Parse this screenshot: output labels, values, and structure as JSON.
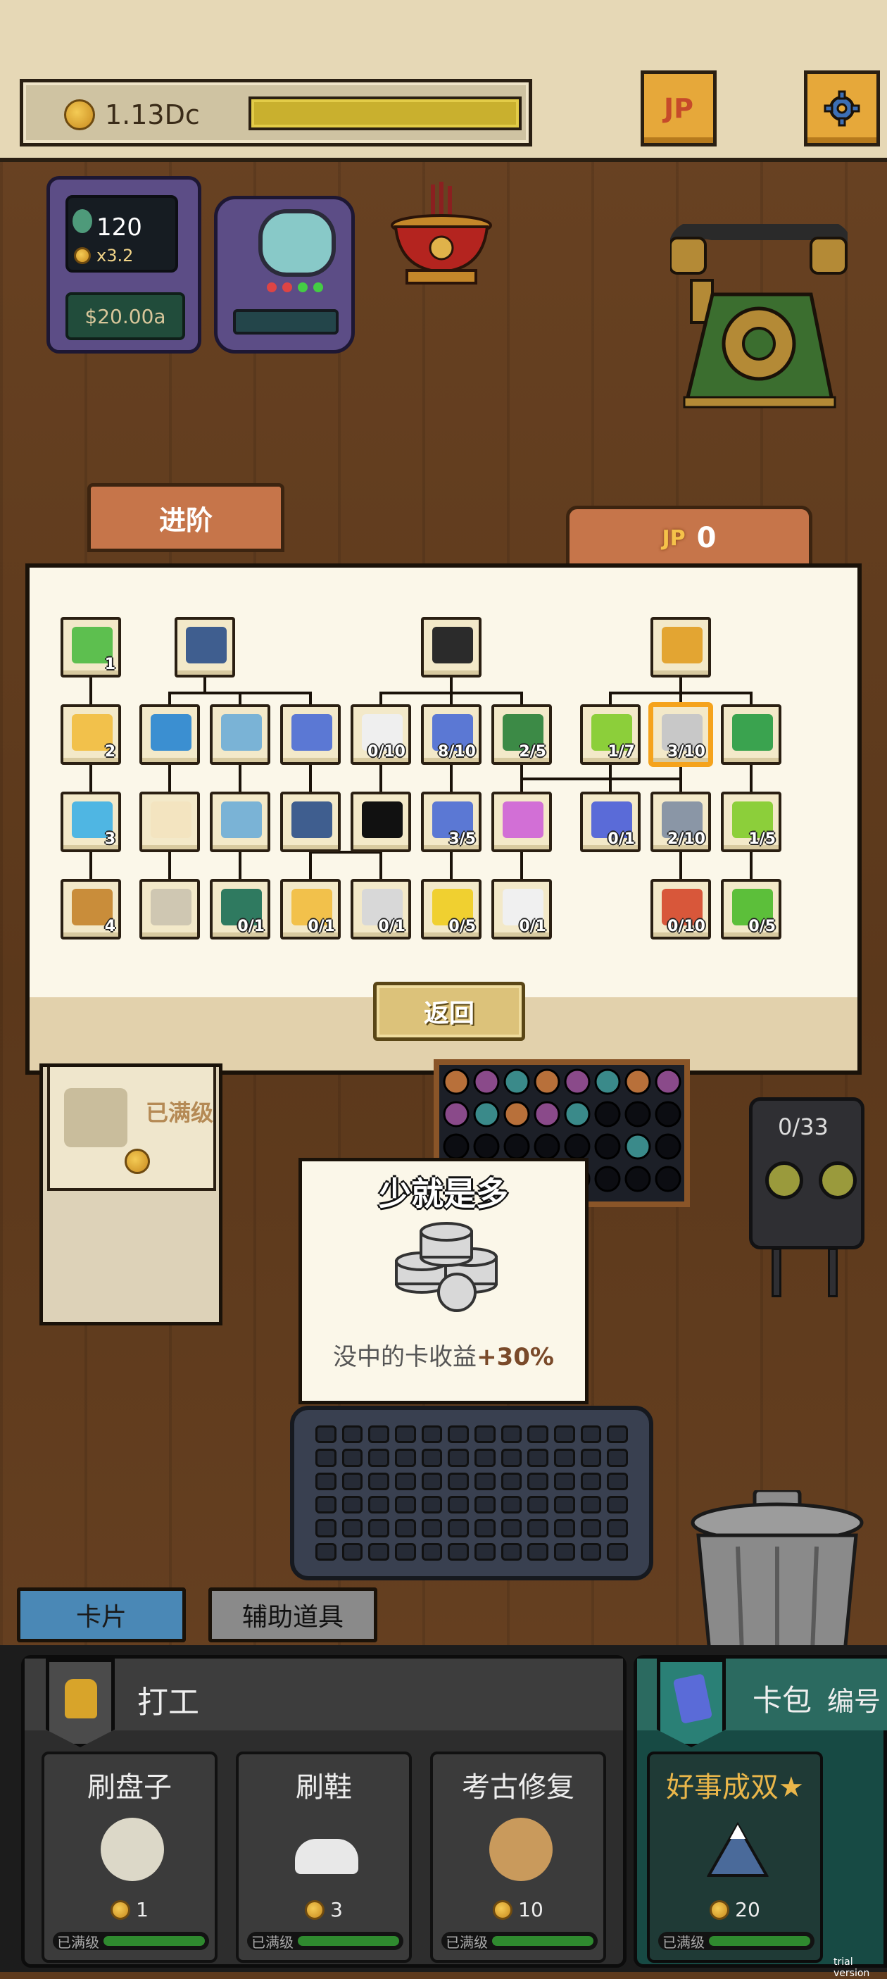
{
  "topbar": {
    "money": "1.13Dc",
    "jp_label": "JP",
    "settings_icon": "gear-icon"
  },
  "machine": {
    "spins": "120",
    "multiplier": "x3.2",
    "cash": "$20.00a"
  },
  "panel": {
    "tab_advance": "进阶",
    "jp_count": "0",
    "back_label": "返回",
    "nodes": [
      {
        "name": "node-root-1",
        "icon": "medkit-icon",
        "count": "1"
      },
      {
        "name": "node-root-2",
        "icon": "robot-icon",
        "count": ""
      },
      {
        "name": "node-root-3",
        "icon": "hat-icon",
        "count": ""
      },
      {
        "name": "node-root-4",
        "icon": "jp-coins-icon",
        "count": ""
      },
      {
        "name": "node-c1-r2",
        "icon": "coin-plus-icon",
        "count": "2"
      },
      {
        "name": "node-c1-r3",
        "icon": "sparkle-icon",
        "count": "3"
      },
      {
        "name": "node-c1-r4",
        "icon": "hourglass-icon",
        "count": "4"
      },
      {
        "name": "node-c2-r2",
        "icon": "upgrade-arrows-icon",
        "count": ""
      },
      {
        "name": "node-c3-r2",
        "icon": "fan-icon",
        "count": ""
      },
      {
        "name": "node-c4-r2",
        "icon": "ticket-icon",
        "count": ""
      },
      {
        "name": "node-c2-r3",
        "icon": "lucky-cat-icon",
        "count": ""
      },
      {
        "name": "node-c3-r3",
        "icon": "fan-icon",
        "count": ""
      },
      {
        "name": "node-c4-r3",
        "icon": "robot-icon",
        "count": ""
      },
      {
        "name": "node-c2-r4",
        "icon": "lucky-cat-trash-icon",
        "count": ""
      },
      {
        "name": "node-c3-r4",
        "icon": "tv-icon",
        "count": "0/1"
      },
      {
        "name": "node-c4-r4",
        "icon": "moon-icon",
        "count": "0/1"
      },
      {
        "name": "node-c5-r2",
        "icon": "plate-icon",
        "count": "0/10"
      },
      {
        "name": "node-c6-r2",
        "icon": "ticket-icon",
        "count": "8/10"
      },
      {
        "name": "node-c7-r2",
        "icon": "question-icon",
        "count": "2/5"
      },
      {
        "name": "node-c5-r3",
        "icon": "lock-icon",
        "count": ""
      },
      {
        "name": "node-c6-r3",
        "icon": "ticket-icon",
        "count": "3/5"
      },
      {
        "name": "node-c7-r3",
        "icon": "wand-icon",
        "count": ""
      },
      {
        "name": "node-c5-r4",
        "icon": "dome-icon",
        "count": "0/1"
      },
      {
        "name": "node-c6-r4",
        "icon": "arrows-icon",
        "count": "0/5"
      },
      {
        "name": "node-c7-r4",
        "icon": "loan-icon",
        "count": "0/1"
      },
      {
        "name": "node-c8-r2",
        "icon": "jack-clover-icon",
        "count": "1/7"
      },
      {
        "name": "node-c9-r2",
        "icon": "coin-stack-icon",
        "count": "3/10"
      },
      {
        "name": "node-c10-r2",
        "icon": "refresh-icon",
        "count": ""
      },
      {
        "name": "node-c8-r3",
        "icon": "basket-icon",
        "count": "0/1"
      },
      {
        "name": "node-c9-r3",
        "icon": "trash-can-icon",
        "count": "2/10"
      },
      {
        "name": "node-c10-r3",
        "icon": "dollar-icon",
        "count": "1/5"
      },
      {
        "name": "node-c9-r4",
        "icon": "cards-icon",
        "count": "0/10"
      },
      {
        "name": "node-c10-r4",
        "icon": "green-arrows-icon",
        "count": "0/5"
      }
    ]
  },
  "left_card": {
    "status": "已满级"
  },
  "robot": {
    "count": "0/33"
  },
  "tooltip": {
    "title": "少就是多",
    "desc": "没中的卡收益",
    "bonus": "+30%"
  },
  "tabs": {
    "cards": "卡片",
    "tools": "辅助道具"
  },
  "work": {
    "title": "打工",
    "jobs": [
      {
        "name": "刷盘子",
        "cost": "1",
        "status": "已满级"
      },
      {
        "name": "刷鞋",
        "cost": "3",
        "status": "已满级"
      },
      {
        "name": "考古修复",
        "cost": "10",
        "status": "已满级"
      }
    ]
  },
  "pack": {
    "title": "卡包",
    "number_label": "编号",
    "job": {
      "name": "好事成双★",
      "cost": "20",
      "status": "已满级"
    }
  },
  "watermark": "trial version",
  "colors": {
    "selected_border": "#f5a31c",
    "panel_bg": "#fbf7e9",
    "tab_orange": "#c6754a"
  }
}
